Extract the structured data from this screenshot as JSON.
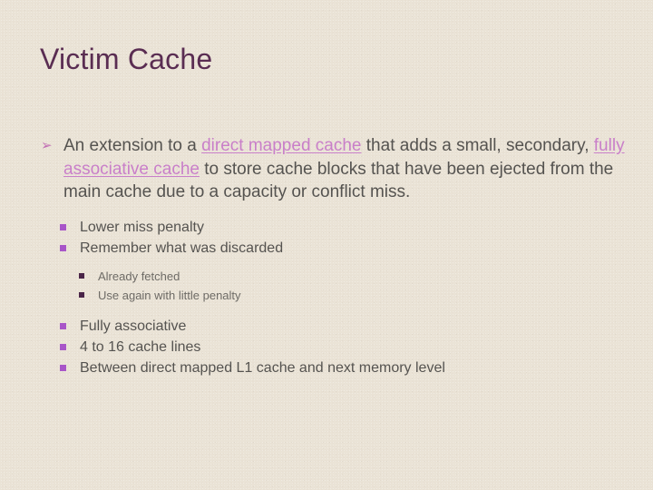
{
  "slide": {
    "title": "Victim Cache",
    "background_color": "#EAE3D6",
    "title_color": "#5A2D52",
    "body_text_color": "#555350",
    "link_color": "#C97FC9",
    "arrow_bullet_color": "#C26FB4",
    "square_bullet_color_l2": "#A855C8",
    "square_bullet_color_l3": "#4A2548",
    "arrow_bullet_glyph": "➢",
    "markers": {
      "arrow_icon_name": "arrow-bullet-icon",
      "square_icon_name": "square-bullet-icon"
    }
  },
  "content": {
    "level1": {
      "segments": {
        "s1": "An extension to a ",
        "link1": "direct mapped cache",
        "s2": " that adds a small, secondary, ",
        "link2": "fully associative cache",
        "s3": " to store cache blocks that have been ejected from the main cache due to a capacity or conflict miss."
      }
    },
    "level2_first": [
      {
        "label": "Lower miss penalty"
      },
      {
        "label": "Remember what was discarded"
      }
    ],
    "level3": [
      {
        "label": "Already fetched"
      },
      {
        "label": "Use again with little penalty"
      }
    ],
    "level2_second": [
      {
        "label": "Fully associative"
      },
      {
        "label": "4 to 16 cache lines"
      },
      {
        "label": "Between direct mapped L1 cache and next memory level"
      }
    ]
  }
}
